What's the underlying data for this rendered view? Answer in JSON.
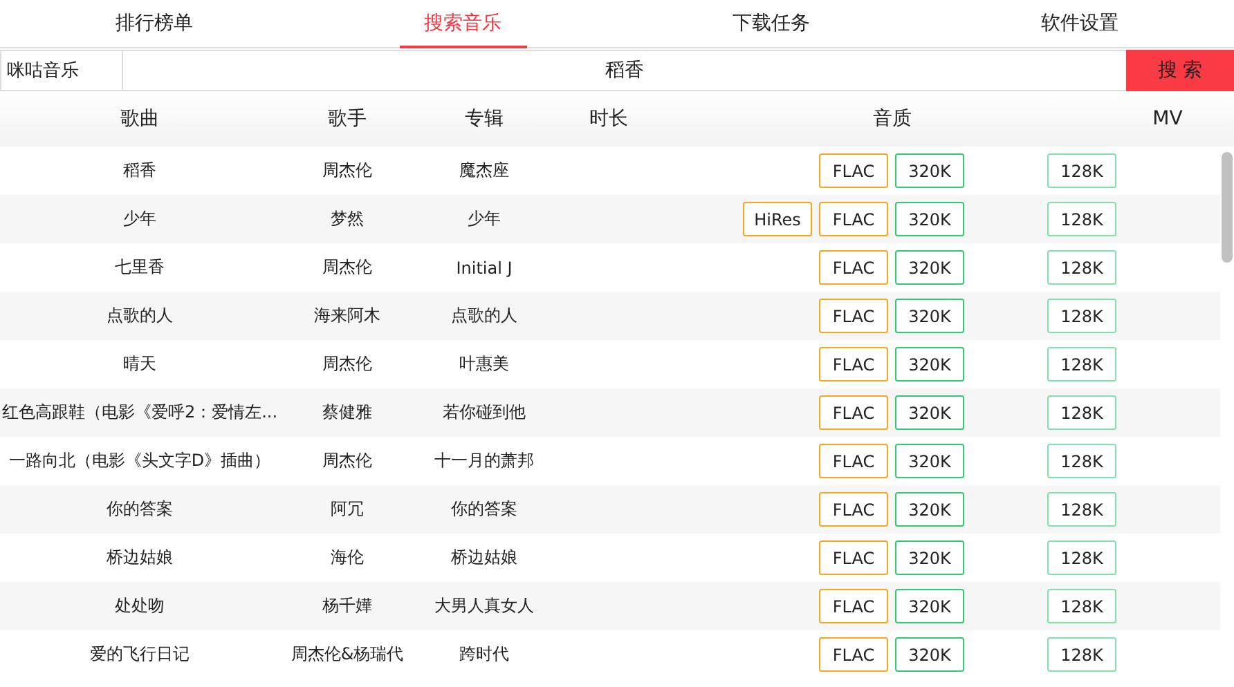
{
  "tabs": [
    {
      "label": "排行榜单",
      "selected": false
    },
    {
      "label": "搜索音乐",
      "selected": true
    },
    {
      "label": "下载任务",
      "selected": false
    },
    {
      "label": "软件设置",
      "selected": false
    }
  ],
  "search": {
    "source": "咪咕音乐",
    "value": "稻香",
    "button": "搜 索"
  },
  "table": {
    "columns": [
      "歌曲",
      "歌手",
      "专辑",
      "时长",
      "音质",
      "MV"
    ],
    "rows": [
      {
        "song": "稻香",
        "singer": "周杰伦",
        "album": "魔杰座",
        "qualities": [
          {
            "kind": "flac",
            "label": "FLAC"
          },
          {
            "kind": "hq",
            "label": "320K"
          },
          {
            "kind": "lq",
            "label": "128K"
          }
        ]
      },
      {
        "song": "少年",
        "singer": "梦然",
        "album": "少年",
        "qualities": [
          {
            "kind": "hires",
            "label": "HiRes"
          },
          {
            "kind": "flac",
            "label": "FLAC"
          },
          {
            "kind": "hq",
            "label": "320K"
          },
          {
            "kind": "lq",
            "label": "128K"
          }
        ]
      },
      {
        "song": "七里香",
        "singer": "周杰伦",
        "album": "Initial J",
        "qualities": [
          {
            "kind": "flac",
            "label": "FLAC"
          },
          {
            "kind": "hq",
            "label": "320K"
          },
          {
            "kind": "lq",
            "label": "128K"
          }
        ]
      },
      {
        "song": "点歌的人",
        "singer": "海来阿木",
        "album": "点歌的人",
        "qualities": [
          {
            "kind": "flac",
            "label": "FLAC"
          },
          {
            "kind": "hq",
            "label": "320K"
          },
          {
            "kind": "lq",
            "label": "128K"
          }
        ]
      },
      {
        "song": "晴天",
        "singer": "周杰伦",
        "album": "叶惠美",
        "qualities": [
          {
            "kind": "flac",
            "label": "FLAC"
          },
          {
            "kind": "hq",
            "label": "320K"
          },
          {
            "kind": "lq",
            "label": "128K"
          }
        ]
      },
      {
        "song": "红色高跟鞋（电影《爱呼2：爱情左...",
        "singer": "蔡健雅",
        "album": "若你碰到他",
        "qualities": [
          {
            "kind": "flac",
            "label": "FLAC"
          },
          {
            "kind": "hq",
            "label": "320K"
          },
          {
            "kind": "lq",
            "label": "128K"
          }
        ]
      },
      {
        "song": "一路向北（电影《头文字D》插曲）",
        "singer": "周杰伦",
        "album": "十一月的萧邦",
        "qualities": [
          {
            "kind": "flac",
            "label": "FLAC"
          },
          {
            "kind": "hq",
            "label": "320K"
          },
          {
            "kind": "lq",
            "label": "128K"
          }
        ]
      },
      {
        "song": "你的答案",
        "singer": "阿冗",
        "album": "你的答案",
        "qualities": [
          {
            "kind": "flac",
            "label": "FLAC"
          },
          {
            "kind": "hq",
            "label": "320K"
          },
          {
            "kind": "lq",
            "label": "128K"
          }
        ]
      },
      {
        "song": "桥边姑娘",
        "singer": "海伦",
        "album": "桥边姑娘",
        "qualities": [
          {
            "kind": "flac",
            "label": "FLAC"
          },
          {
            "kind": "hq",
            "label": "320K"
          },
          {
            "kind": "lq",
            "label": "128K"
          }
        ]
      },
      {
        "song": "处处吻",
        "singer": "杨千嬅",
        "album": "大男人真女人",
        "qualities": [
          {
            "kind": "flac",
            "label": "FLAC"
          },
          {
            "kind": "hq",
            "label": "320K"
          },
          {
            "kind": "lq",
            "label": "128K"
          }
        ]
      },
      {
        "song": "爱的飞行日记",
        "singer": "周杰伦&杨瑞代",
        "album": "跨时代",
        "qualities": [
          {
            "kind": "flac",
            "label": "FLAC"
          },
          {
            "kind": "hq",
            "label": "320K"
          },
          {
            "kind": "lq",
            "label": "128K"
          }
        ]
      }
    ]
  }
}
